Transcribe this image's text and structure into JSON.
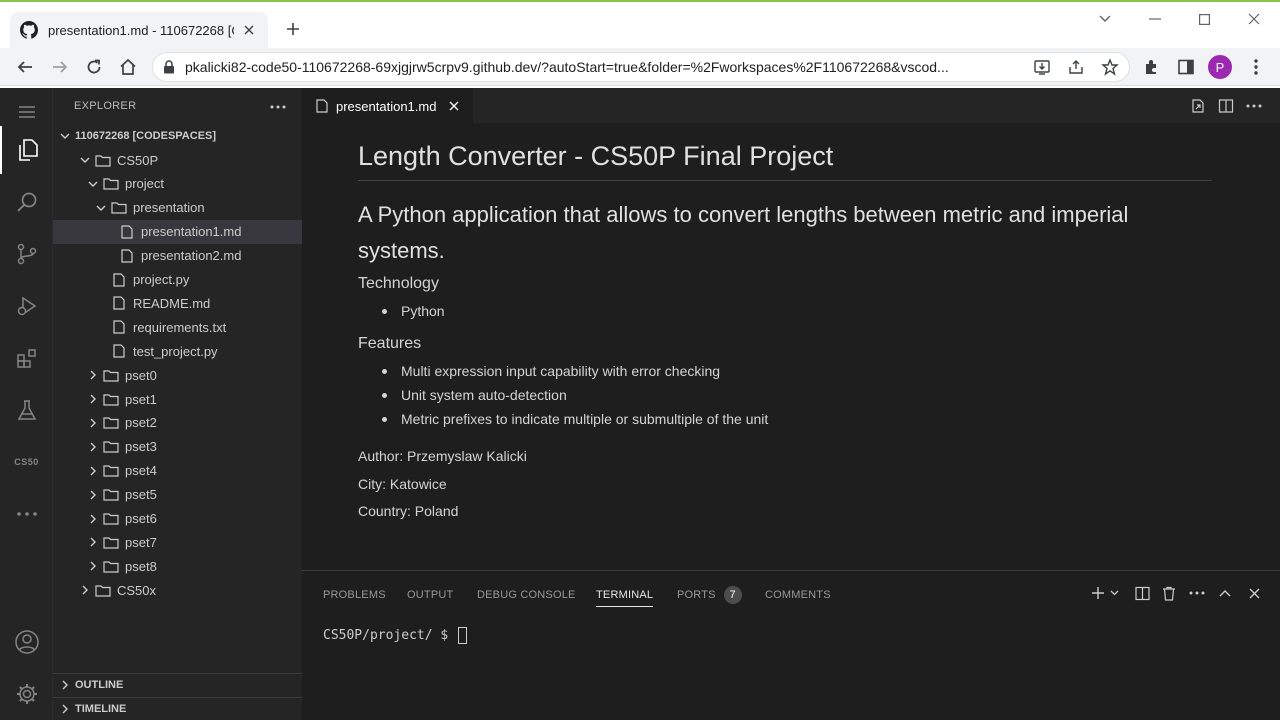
{
  "browser": {
    "tab_title": "presentation1.md - 110672268 [C",
    "url": "pkalicki82-code50-110672268-69xjgjrw5crpv9.github.dev/?autoStart=true&folder=%2Fworkspaces%2F110672268&vscod...",
    "profile_initial": "P",
    "accent_color": "#8bc34a"
  },
  "explorer": {
    "header": "EXPLORER",
    "root": "110672268 [CODESPACES]",
    "items": [
      {
        "label": "CS50P",
        "kind": "folder",
        "expanded": true
      },
      {
        "label": "project",
        "kind": "folder",
        "expanded": true
      },
      {
        "label": "presentation",
        "kind": "folder",
        "expanded": true
      },
      {
        "label": "presentation1.md",
        "kind": "file",
        "selected": true
      },
      {
        "label": "presentation2.md",
        "kind": "file"
      },
      {
        "label": "project.py",
        "kind": "file"
      },
      {
        "label": "README.md",
        "kind": "file"
      },
      {
        "label": "requirements.txt",
        "kind": "file"
      },
      {
        "label": "test_project.py",
        "kind": "file"
      },
      {
        "label": "pset0",
        "kind": "folder"
      },
      {
        "label": "pset1",
        "kind": "folder"
      },
      {
        "label": "pset2",
        "kind": "folder"
      },
      {
        "label": "pset3",
        "kind": "folder"
      },
      {
        "label": "pset4",
        "kind": "folder"
      },
      {
        "label": "pset5",
        "kind": "folder"
      },
      {
        "label": "pset6",
        "kind": "folder"
      },
      {
        "label": "pset7",
        "kind": "folder"
      },
      {
        "label": "pset8",
        "kind": "folder"
      },
      {
        "label": "CS50x",
        "kind": "folder"
      }
    ],
    "outline": "OUTLINE",
    "timeline": "TIMELINE"
  },
  "activity": {
    "cs50_label": "CS50"
  },
  "editor": {
    "tab_label": "presentation1.md"
  },
  "preview": {
    "title": "Length Converter - CS50P Final Project",
    "subtitle": "A Python application that allows to convert lengths between metric and imperial systems.",
    "technology_heading": "Technology",
    "technology": [
      "Python"
    ],
    "features_heading": "Features",
    "features": [
      "Multi expression input capability with error checking",
      "Unit system auto-detection",
      "Metric prefixes to indicate multiple or submultiple of the unit"
    ],
    "author": "Author: Przemyslaw Kalicki",
    "city": "City: Katowice",
    "country": "Country: Poland"
  },
  "panel": {
    "tabs": [
      "PROBLEMS",
      "OUTPUT",
      "DEBUG CONSOLE",
      "TERMINAL",
      "PORTS",
      "COMMENTS"
    ],
    "active_tab": "TERMINAL",
    "ports_count": "7",
    "prompt": "CS50P/project/ $ "
  }
}
